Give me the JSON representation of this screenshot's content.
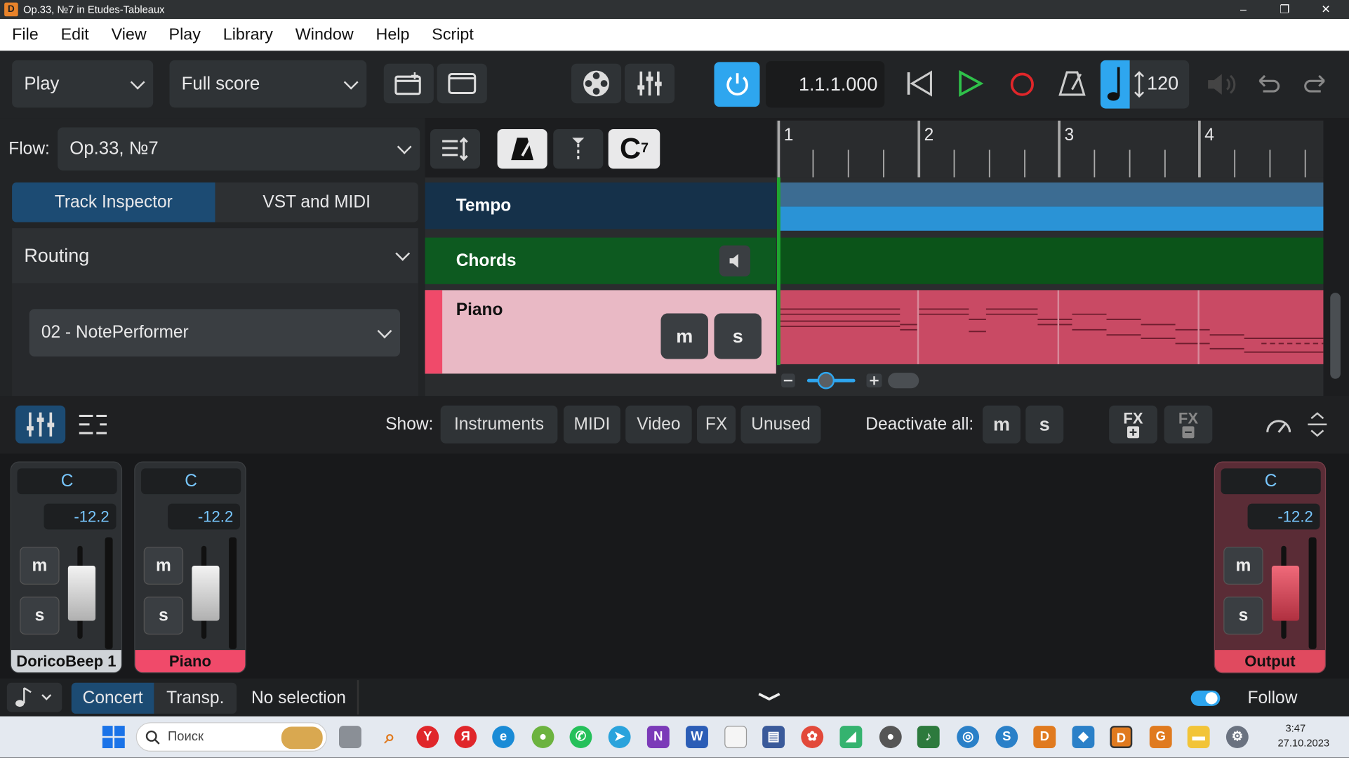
{
  "window": {
    "title": "Op.33, №7 in Etudes-Tableaux",
    "min": "–",
    "max": "❐",
    "close": "✕"
  },
  "menu": [
    "File",
    "Edit",
    "View",
    "Play",
    "Library",
    "Window",
    "Help",
    "Script"
  ],
  "toolbar": {
    "mode": "Play",
    "layout": "Full score",
    "position": "1.1.1.000",
    "tempo": "120",
    "colors": {
      "accent": "#2ea6ef",
      "play": "#2fc14a",
      "record": "#e0262a"
    }
  },
  "flow": {
    "label": "Flow:",
    "value": "Op.33, №7",
    "chord_symbol": "C",
    "chord_sup": "7"
  },
  "inspector": {
    "tabs": [
      "Track Inspector",
      "VST and MIDI"
    ],
    "section": "Routing",
    "device": "02 - NotePerformer"
  },
  "tracks": [
    {
      "name": "Tempo",
      "color": "#15314a",
      "lane": "#2a93d6"
    },
    {
      "name": "Chords",
      "color": "#0d5a20",
      "lane": "#0b5419"
    },
    {
      "name": "Piano",
      "color": "#e9b9c5",
      "lane": "#c94a64"
    }
  ],
  "track_buttons": {
    "mute": "m",
    "solo": "s"
  },
  "ruler": [
    "1",
    "2",
    "3",
    "4"
  ],
  "mixer": {
    "show_label": "Show:",
    "filters": [
      {
        "label": "Instruments",
        "active": true
      },
      {
        "label": "MIDI",
        "active": false
      },
      {
        "label": "Video",
        "active": false
      },
      {
        "label": "FX",
        "active": true
      },
      {
        "label": "Unused",
        "active": false
      }
    ],
    "deactivate_label": "Deactivate all:",
    "fx_add": "FX",
    "fx_remove": "FX",
    "channels": [
      {
        "name": "DoricoBeep 1",
        "pan": "C",
        "volume": "-12.2",
        "color": "#cfd3d7"
      },
      {
        "name": "Piano",
        "pan": "C",
        "volume": "-12.2",
        "color": "#f04a6a"
      },
      {
        "name": "Output",
        "pan": "C",
        "volume": "-12.2",
        "color": "#e04a5f"
      }
    ]
  },
  "status": {
    "concert": "Concert",
    "transp": "Transp.",
    "selection": "No selection",
    "follow": "Follow"
  },
  "taskbar": {
    "search": "Поиск",
    "time": "3:47",
    "date": "27.10.2023"
  }
}
